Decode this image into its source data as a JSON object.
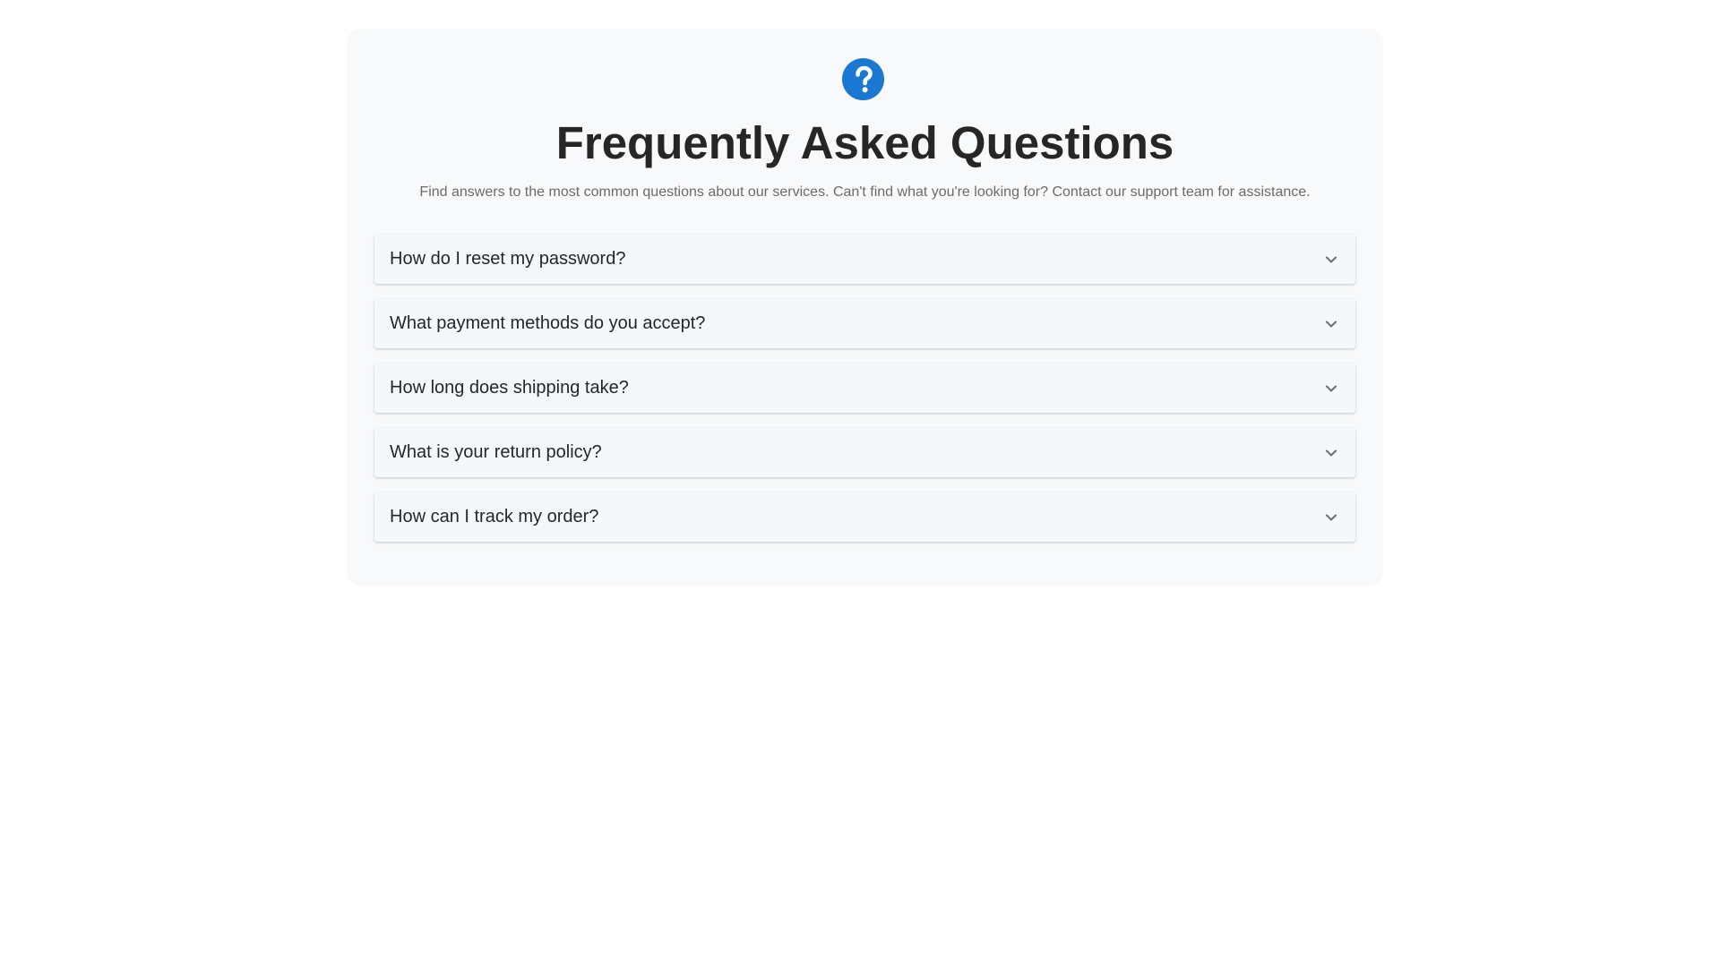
{
  "header": {
    "icon": "question-circle-icon",
    "title": "Frequently Asked Questions",
    "subtitle": "Find answers to the most common questions about our services. Can't find what you're looking for? Contact our support team for assistance."
  },
  "faq": {
    "items": [
      {
        "question": "How do I reset my password?",
        "icon": "chevron-down-icon"
      },
      {
        "question": "What payment methods do you accept?",
        "icon": "chevron-down-icon"
      },
      {
        "question": "How long does shipping take?",
        "icon": "chevron-down-icon"
      },
      {
        "question": "What is your return policy?",
        "icon": "chevron-down-icon"
      },
      {
        "question": "How can I track my order?",
        "icon": "chevron-down-icon"
      }
    ]
  },
  "colors": {
    "accent": "#1a78d2",
    "card_background": "#f8f9fa",
    "item_background": "#f5f8fb",
    "text": "#262626",
    "muted_text": "#6b6b6b"
  }
}
